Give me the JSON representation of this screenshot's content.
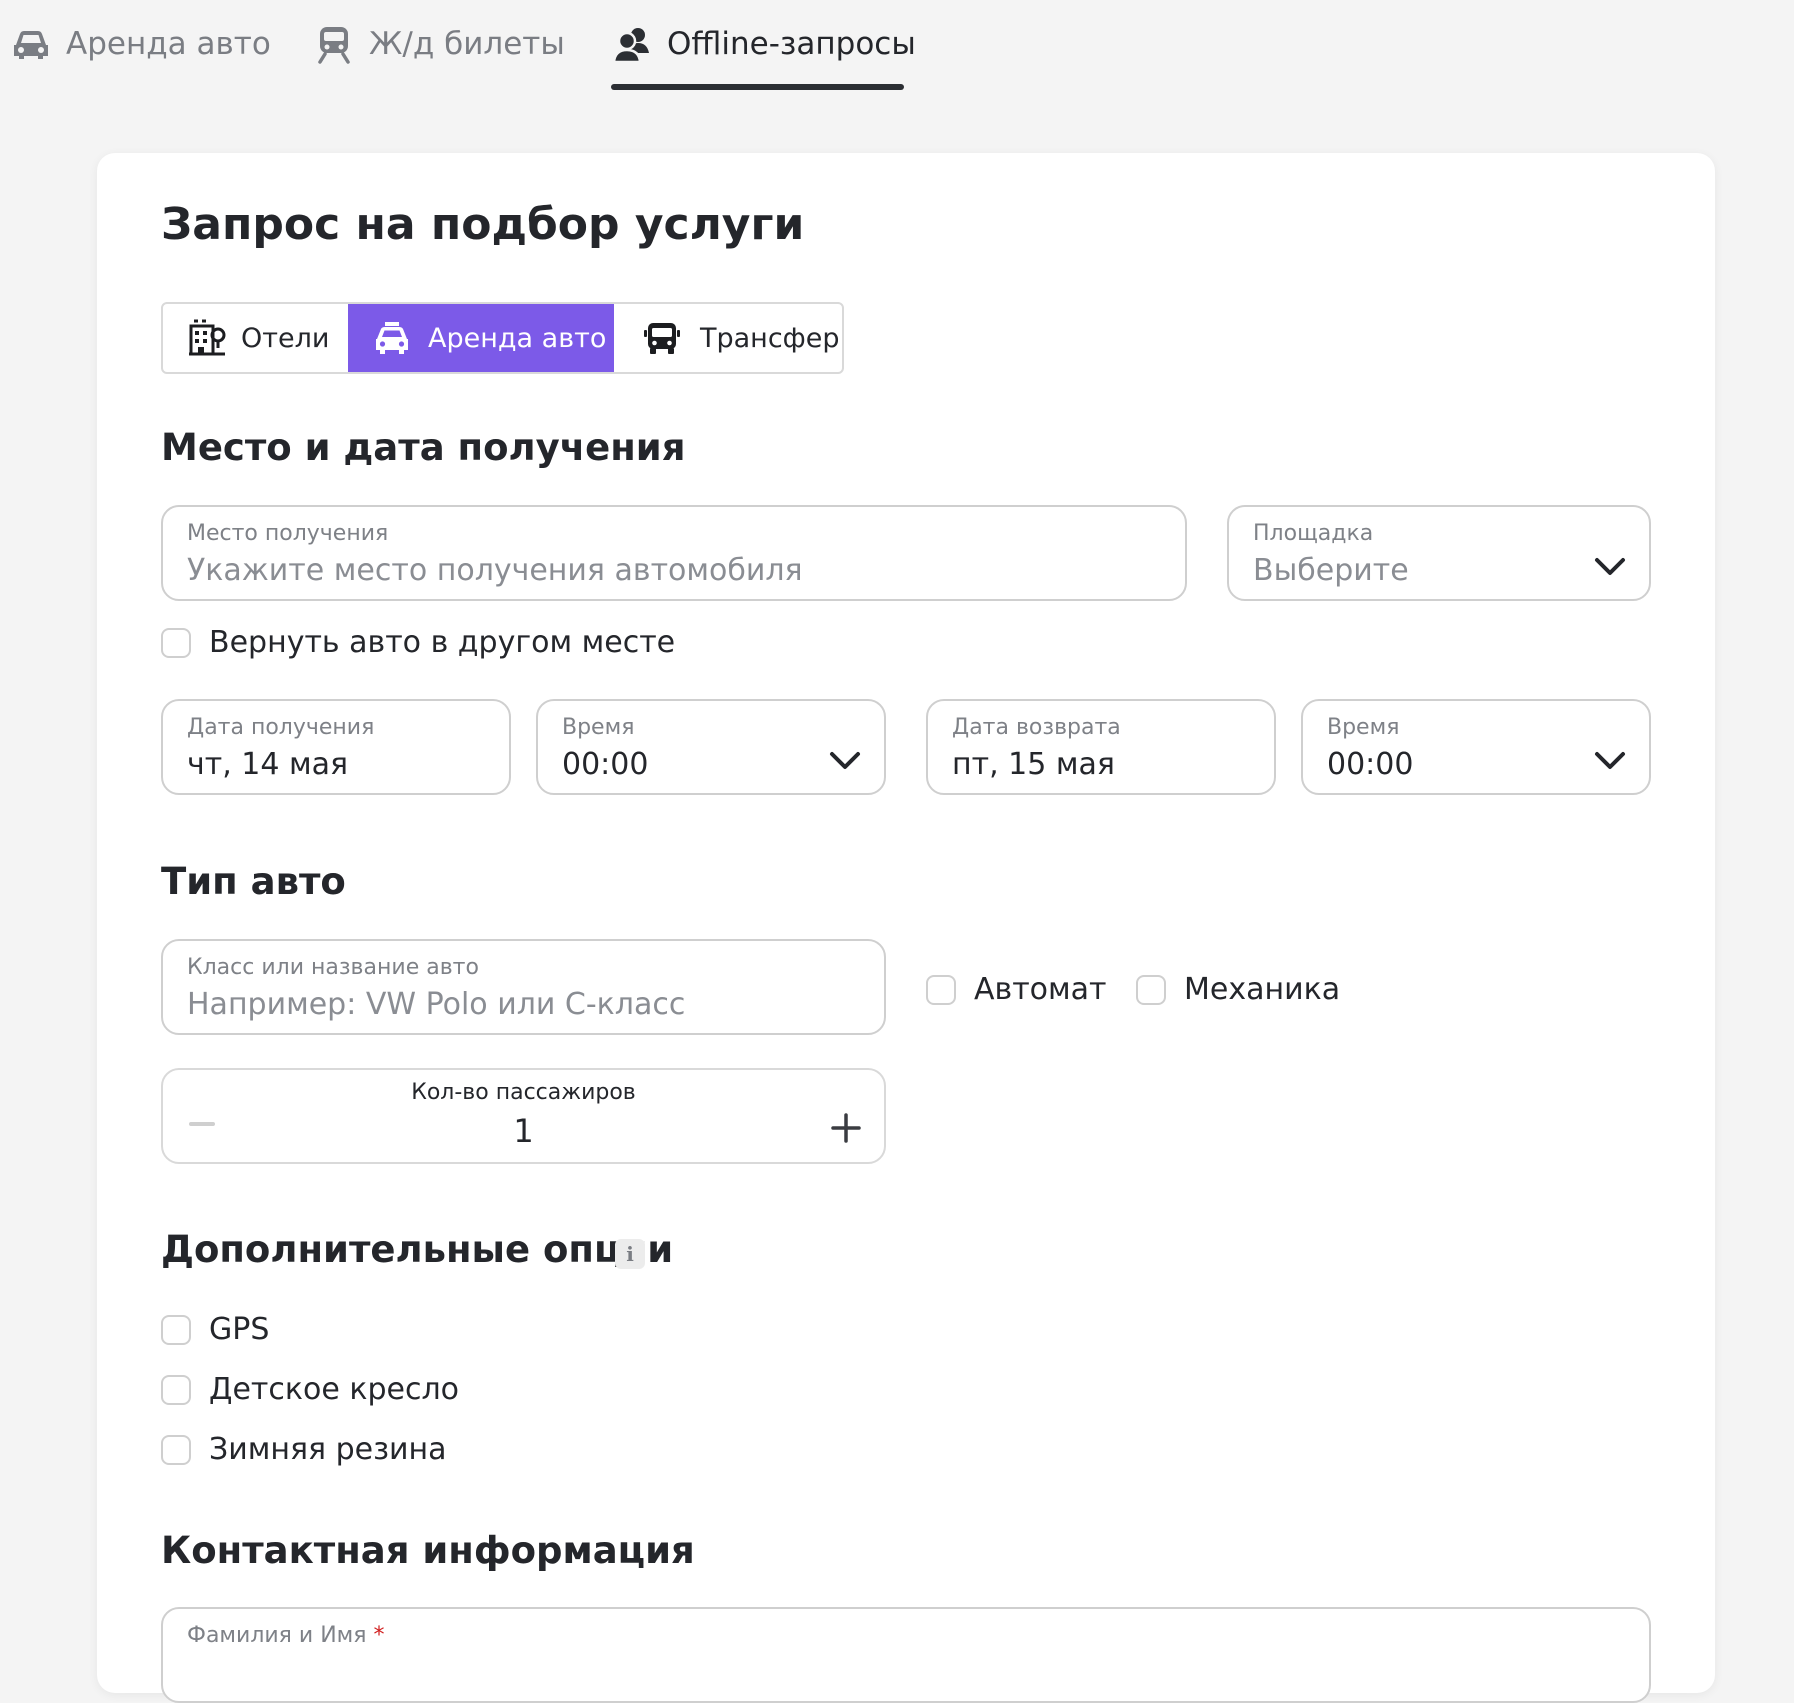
{
  "topnav": {
    "tabs": [
      {
        "label": "Аренда авто",
        "icon": "car-icon"
      },
      {
        "label": "Ж/д билеты",
        "icon": "train-icon"
      },
      {
        "label": "Offline-запросы",
        "icon": "users-icon",
        "active": true
      }
    ]
  },
  "form": {
    "title": "Запрос на подбор услуги",
    "services": [
      {
        "label": "Отели",
        "icon": "hotel-icon"
      },
      {
        "label": "Аренда авто",
        "icon": "car-icon",
        "selected": true
      },
      {
        "label": "Трансфер",
        "icon": "bus-icon"
      }
    ],
    "pickup_section": {
      "heading": "Место и дата получения",
      "place": {
        "label": "Место получения",
        "placeholder": "Укажите место получения автомобиля"
      },
      "platform": {
        "label": "Площадка",
        "value": "Выберите"
      },
      "return_elsewhere": "Вернуть авто в другом месте",
      "pickup_date": {
        "label": "Дата получения",
        "value": "чт, 14 мая"
      },
      "pickup_time": {
        "label": "Время",
        "value": "00:00"
      },
      "return_date": {
        "label": "Дата возврата",
        "value": "пт, 15 мая"
      },
      "return_time": {
        "label": "Время",
        "value": "00:00"
      }
    },
    "car_section": {
      "heading": "Тип авто",
      "car_class": {
        "label": "Класс или название авто",
        "placeholder": "Например: VW Polo или С-класс"
      },
      "automatic": "Автомат",
      "manual": "Механика",
      "passengers": {
        "label": "Кол-во пассажиров",
        "value": "1"
      }
    },
    "options_section": {
      "heading": "Дополнительные опции",
      "info": "i",
      "options": [
        "GPS",
        "Детское кресло",
        "Зимняя резина"
      ]
    },
    "contact_section": {
      "heading": "Контактная информация",
      "name": {
        "label": "Фамилия и Имя",
        "required_mark": "*"
      }
    }
  },
  "colors": {
    "accent": "#7c5ae8",
    "text": "#24262b",
    "muted": "#7a7d83",
    "border": "#cfcfcf",
    "required": "#d11f1f"
  }
}
